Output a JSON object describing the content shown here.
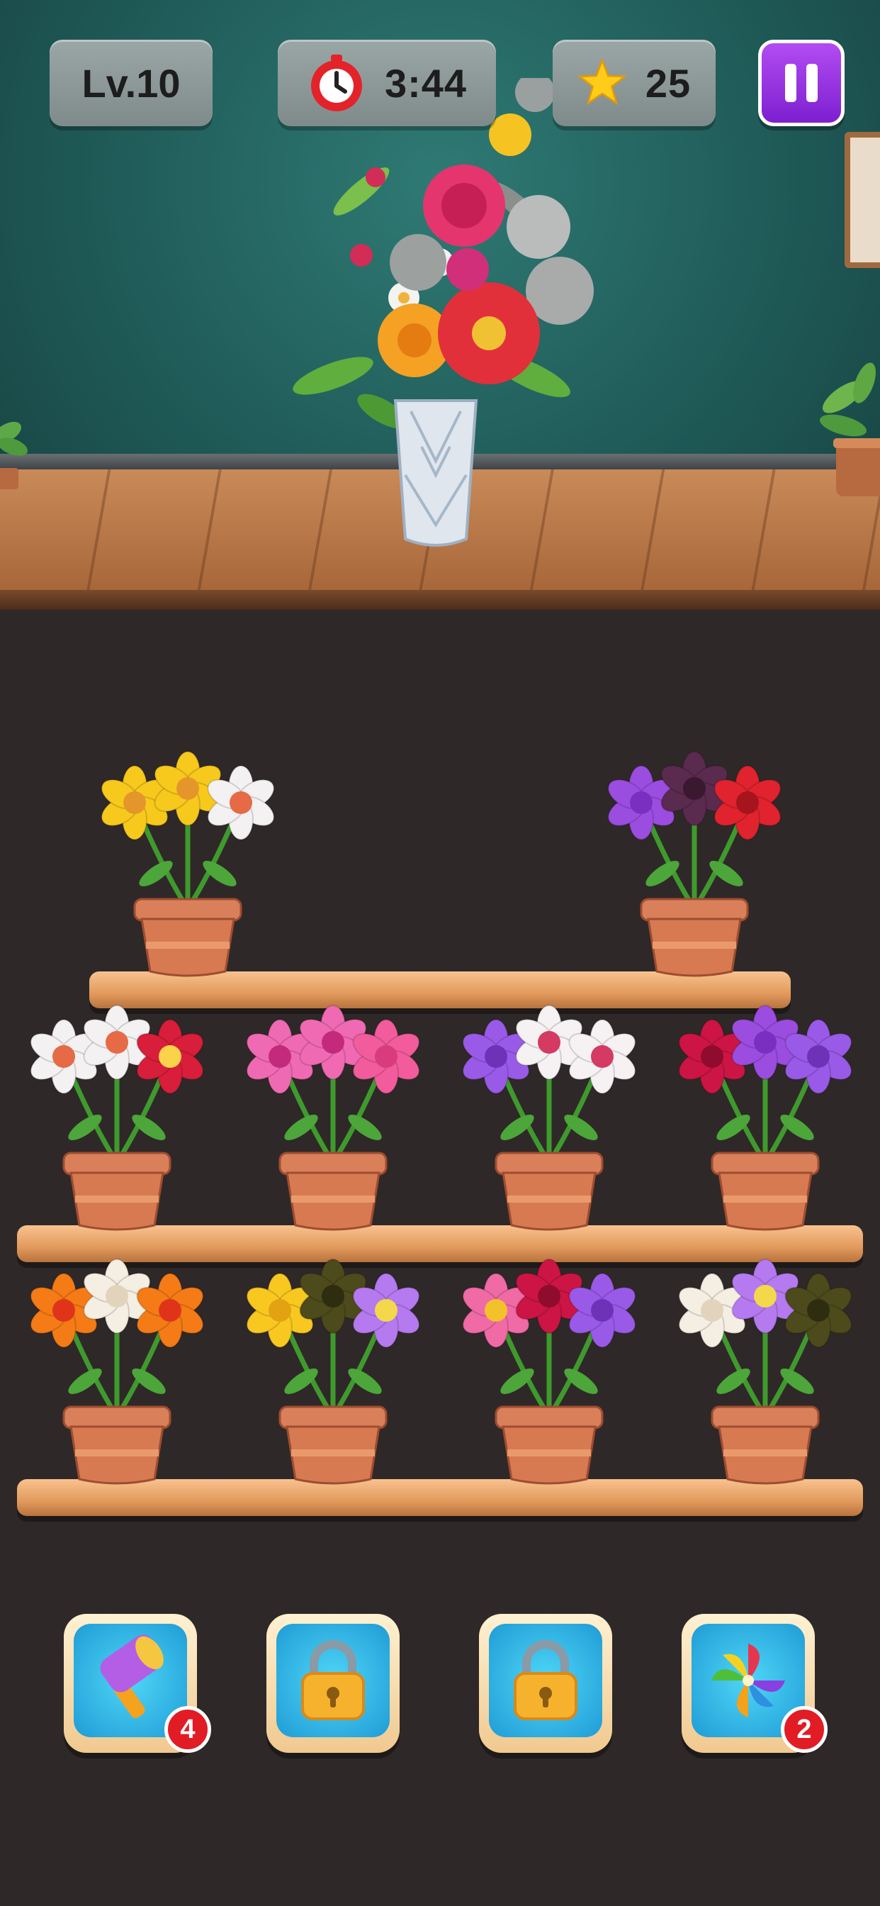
{
  "hud": {
    "level_label": "Lv.10",
    "timer_label": "3:44",
    "stars_label": "25",
    "timer_icon": "stopwatch-icon",
    "star_icon": "star-icon",
    "pause_icon": "pause-icon"
  },
  "bouquet": {
    "vase": "crystal-vase",
    "flowers": [
      "rose",
      "dahlia",
      "daisy",
      "lily",
      "grey-rose"
    ]
  },
  "shelves": [
    {
      "pots": [
        {
          "flowers": [
            "yellow-lily",
            "yellow-lily",
            "white-lily"
          ]
        },
        null,
        null,
        {
          "flowers": [
            "purple-tulip",
            "dark-chrysanthemum",
            "red-rose"
          ]
        }
      ]
    },
    {
      "pots": [
        {
          "flowers": [
            "white-lily",
            "white-lily",
            "red-hibiscus"
          ]
        },
        {
          "flowers": [
            "pink-hibiscus",
            "pink-hibiscus",
            "pink-tulip"
          ]
        },
        {
          "flowers": [
            "purple-peony",
            "white-hibiscus",
            "white-hibiscus"
          ]
        },
        {
          "flowers": [
            "red-tulip",
            "purple-tulip",
            "purple-peony"
          ]
        }
      ]
    },
    {
      "pots": [
        {
          "flowers": [
            "orange-hibiscus",
            "white-rose",
            "orange-hibiscus"
          ]
        },
        {
          "flowers": [
            "yellow-rose",
            "dark-rose",
            "lilac-lotus"
          ]
        },
        {
          "flowers": [
            "pink-gerbera",
            "red-tulip",
            "purple-peony"
          ]
        },
        {
          "flowers": [
            "white-rose",
            "lilac-lotus",
            "dark-rose"
          ]
        }
      ]
    }
  ],
  "tools": [
    {
      "icon": "hammer-icon",
      "count": "4",
      "locked": false
    },
    {
      "icon": "lock-icon",
      "count": null,
      "locked": true
    },
    {
      "icon": "lock-icon",
      "count": null,
      "locked": true
    },
    {
      "icon": "pinwheel-icon",
      "count": "2",
      "locked": false
    }
  ],
  "colors": {
    "wall": "#1f5a57",
    "floor": "#c98a58",
    "background": "#2f2828",
    "pause_button": "#9b38e6",
    "badge": "#e11c25",
    "tool_face": "#2fb4e8",
    "shelf": "#e29a5c"
  }
}
